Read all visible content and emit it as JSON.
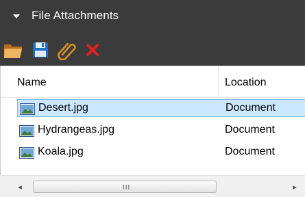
{
  "panel": {
    "title": "File Attachments",
    "collapse_icon": "caret-down-icon"
  },
  "toolbar": {
    "buttons": [
      {
        "name": "open-folder",
        "icon": "folder-open-icon",
        "color": "#e0a040"
      },
      {
        "name": "save",
        "icon": "floppy-disk-icon",
        "color": "#1f6fc9"
      },
      {
        "name": "attach",
        "icon": "paperclip-icon",
        "color": "#d8902c"
      },
      {
        "name": "delete",
        "icon": "red-x-icon",
        "color": "#e02020"
      }
    ]
  },
  "list": {
    "columns": [
      "Name",
      "Location"
    ],
    "rows": [
      {
        "name": "Desert.jpg",
        "location": "Document",
        "selected": true
      },
      {
        "name": "Hydrangeas.jpg",
        "location": "Document",
        "selected": false
      },
      {
        "name": "Koala.jpg",
        "location": "Document",
        "selected": false
      }
    ]
  },
  "scrollbar": {
    "left_arrow": "◂",
    "right_arrow": "▸",
    "grip": "III"
  },
  "colors": {
    "header_bg": "#3b3b3b",
    "selection_bg": "#cce8ff",
    "selection_border": "#7ab8ec"
  }
}
